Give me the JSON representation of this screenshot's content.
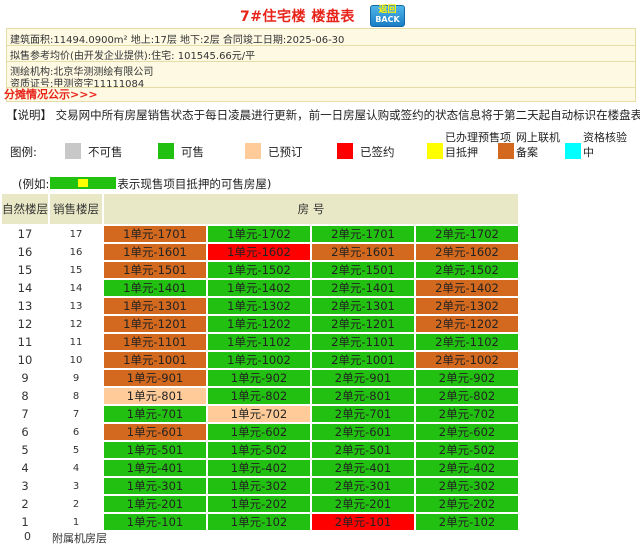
{
  "header": {
    "title": "7#住宅楼 楼盘表",
    "back_cn": "返回",
    "back_en": "BACK"
  },
  "info": {
    "area_line": "建筑面积:11494.0900m² 地上:17层 地下:2层 合同竣工日期:2025-06-30",
    "price_line": "拟售参考均价(由开发企业提供):住宅: 101545.66元/平",
    "agency_line": "测绘机构:北京华测测绘有限公司",
    "cert_line": "资质证号:甲测资字11111084",
    "sale_link": "分摊情况公示>>>"
  },
  "note": "【说明】 交易网中所有房屋销售状态于每日凌晨进行更新，前一日房屋认购或签约的状态信息将于第二天起自动标识在楼盘表中。",
  "legend": {
    "label": "图例:",
    "items": [
      {
        "name": "not-for-sale",
        "text": "不可售",
        "color": "#c8c8c8"
      },
      {
        "name": "available",
        "text": "可售",
        "color": "#22c011"
      },
      {
        "name": "booked",
        "text": "已预订",
        "color": "#ffcc99"
      },
      {
        "name": "signed",
        "text": "已签约",
        "color": "#ff0000"
      },
      {
        "name": "mortgaged",
        "text": "已办理预售项目抵押",
        "color": "#ffff00"
      },
      {
        "name": "online-filed",
        "text": "网上联机备案",
        "color": "#d2691e"
      },
      {
        "name": "qualification",
        "text": "资格核验中",
        "color": "#00ffff"
      }
    ]
  },
  "example": {
    "prefix": "(例如:",
    "suffix": "表示现售项目抵押的可售房屋)"
  },
  "table": {
    "header_floor": "自然楼层",
    "header_sale": "销售楼层",
    "header_room": "房 号",
    "rows": [
      {
        "f": "17",
        "s": "17",
        "u": [
          [
            "1单元-1701",
            "web"
          ],
          [
            "1单元-1702",
            "avail"
          ],
          [
            "2单元-1701",
            "avail"
          ],
          [
            "2单元-1702",
            "avail"
          ]
        ]
      },
      {
        "f": "16",
        "s": "16",
        "u": [
          [
            "1单元-1601",
            "web"
          ],
          [
            "1单元-1602",
            "signed"
          ],
          [
            "2单元-1601",
            "web"
          ],
          [
            "2单元-1602",
            "web"
          ]
        ]
      },
      {
        "f": "15",
        "s": "15",
        "u": [
          [
            "1单元-1501",
            "web"
          ],
          [
            "1单元-1502",
            "avail"
          ],
          [
            "2单元-1501",
            "avail"
          ],
          [
            "2单元-1502",
            "avail"
          ]
        ]
      },
      {
        "f": "14",
        "s": "14",
        "u": [
          [
            "1单元-1401",
            "avail"
          ],
          [
            "1单元-1402",
            "avail"
          ],
          [
            "2单元-1401",
            "avail"
          ],
          [
            "2单元-1402",
            "web"
          ]
        ]
      },
      {
        "f": "13",
        "s": "13",
        "u": [
          [
            "1单元-1301",
            "web"
          ],
          [
            "1单元-1302",
            "avail"
          ],
          [
            "2单元-1301",
            "avail"
          ],
          [
            "2单元-1302",
            "web"
          ]
        ]
      },
      {
        "f": "12",
        "s": "12",
        "u": [
          [
            "1单元-1201",
            "web"
          ],
          [
            "1单元-1202",
            "avail"
          ],
          [
            "2单元-1201",
            "avail"
          ],
          [
            "2单元-1202",
            "web"
          ]
        ]
      },
      {
        "f": "11",
        "s": "11",
        "u": [
          [
            "1单元-1101",
            "web"
          ],
          [
            "1单元-1102",
            "avail"
          ],
          [
            "2单元-1101",
            "avail"
          ],
          [
            "2单元-1102",
            "avail"
          ]
        ]
      },
      {
        "f": "10",
        "s": "10",
        "u": [
          [
            "1单元-1001",
            "web"
          ],
          [
            "1单元-1002",
            "avail"
          ],
          [
            "2单元-1001",
            "avail"
          ],
          [
            "2单元-1002",
            "web"
          ]
        ]
      },
      {
        "f": "9",
        "s": "9",
        "u": [
          [
            "1单元-901",
            "web"
          ],
          [
            "1单元-902",
            "avail"
          ],
          [
            "2单元-901",
            "avail"
          ],
          [
            "2单元-902",
            "avail"
          ]
        ]
      },
      {
        "f": "8",
        "s": "8",
        "u": [
          [
            "1单元-801",
            "booked"
          ],
          [
            "1单元-802",
            "avail"
          ],
          [
            "2单元-801",
            "avail"
          ],
          [
            "2单元-802",
            "avail"
          ]
        ]
      },
      {
        "f": "7",
        "s": "7",
        "u": [
          [
            "1单元-701",
            "avail"
          ],
          [
            "1单元-702",
            "booked"
          ],
          [
            "2单元-701",
            "avail"
          ],
          [
            "2单元-702",
            "avail"
          ]
        ]
      },
      {
        "f": "6",
        "s": "6",
        "u": [
          [
            "1单元-601",
            "web"
          ],
          [
            "1单元-602",
            "avail"
          ],
          [
            "2单元-601",
            "avail"
          ],
          [
            "2单元-602",
            "avail"
          ]
        ]
      },
      {
        "f": "5",
        "s": "5",
        "u": [
          [
            "1单元-501",
            "avail"
          ],
          [
            "1单元-502",
            "avail"
          ],
          [
            "2单元-501",
            "avail"
          ],
          [
            "2单元-502",
            "avail"
          ]
        ]
      },
      {
        "f": "4",
        "s": "4",
        "u": [
          [
            "1单元-401",
            "avail"
          ],
          [
            "1单元-402",
            "avail"
          ],
          [
            "2单元-401",
            "avail"
          ],
          [
            "2单元-402",
            "avail"
          ]
        ]
      },
      {
        "f": "3",
        "s": "3",
        "u": [
          [
            "1单元-301",
            "avail"
          ],
          [
            "1单元-302",
            "avail"
          ],
          [
            "2单元-301",
            "avail"
          ],
          [
            "2单元-302",
            "avail"
          ]
        ]
      },
      {
        "f": "2",
        "s": "2",
        "u": [
          [
            "1单元-201",
            "avail"
          ],
          [
            "1单元-202",
            "avail"
          ],
          [
            "2单元-201",
            "avail"
          ],
          [
            "2单元-202",
            "avail"
          ]
        ]
      },
      {
        "f": "1",
        "s": "1",
        "u": [
          [
            "1单元-101",
            "avail"
          ],
          [
            "1单元-102",
            "avail"
          ],
          [
            "2单元-101",
            "signed"
          ],
          [
            "2单元-102",
            "avail"
          ]
        ]
      }
    ],
    "bottom_floor": "0",
    "bottom_label": "附属机房层"
  }
}
